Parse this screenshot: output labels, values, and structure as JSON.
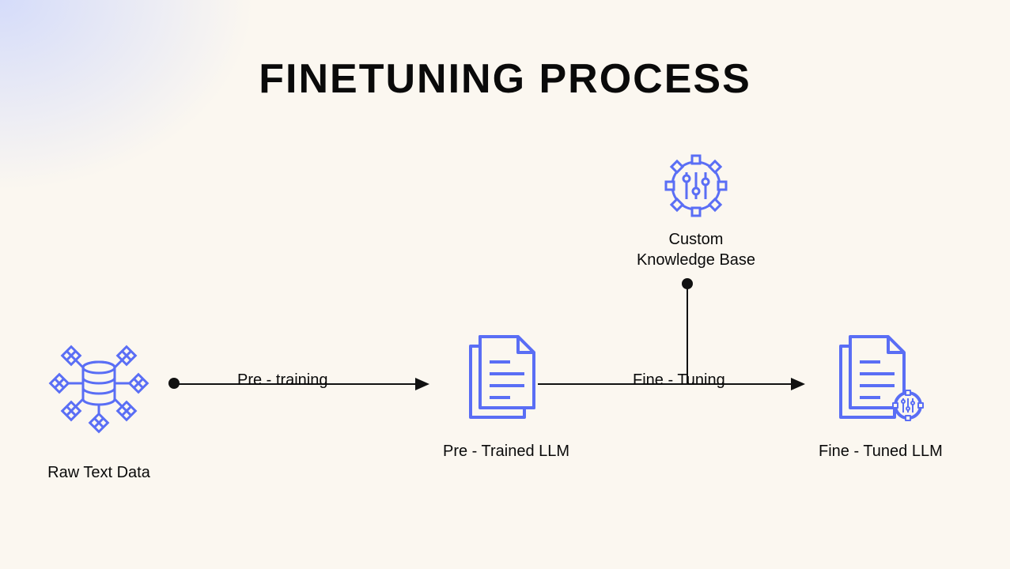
{
  "title": "FINETUNING PROCESS",
  "nodes": {
    "raw_text": {
      "label": "Raw Text Data"
    },
    "pre_trained": {
      "label": "Pre - Trained LLM"
    },
    "custom_kb": {
      "label": "Custom\nKnowledge Base"
    },
    "fine_tuned": {
      "label": "Fine - Tuned LLM"
    }
  },
  "edges": {
    "pre_training": {
      "label": "Pre - training"
    },
    "fine_tuning": {
      "label": "Fine - Tuning"
    }
  },
  "colors": {
    "icon": "#5a6ef5",
    "line": "#111111"
  }
}
